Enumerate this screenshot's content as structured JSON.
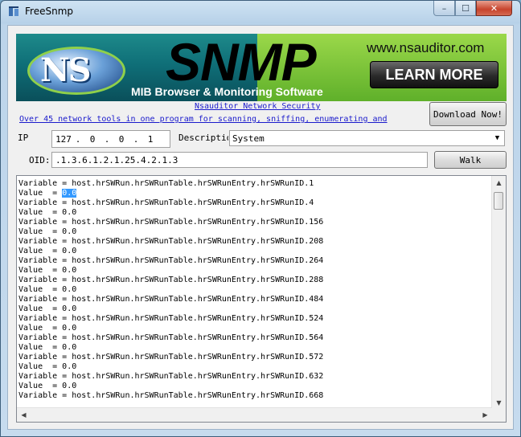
{
  "window": {
    "title": "FreeSnmp",
    "controls": {
      "minimize": "–",
      "maximize": "☐",
      "close": "✕"
    }
  },
  "banner": {
    "logo": "NS",
    "product": "SNMP",
    "subtitle": "MIB Browser & Monitoring Software",
    "url": "www.nsauditor.com",
    "learn_more": "LEARN MORE"
  },
  "links": {
    "vendor": "Nsauditor Network Security",
    "promo": "Over 45 network tools in one program for scanning, sniffing, enumerating and"
  },
  "buttons": {
    "download": "Download Now!",
    "walk": "Walk"
  },
  "form": {
    "ip_label": "IP",
    "ip_octets": [
      "127",
      "0",
      "0",
      "1"
    ],
    "description_label": "Description",
    "description_value": "System",
    "oid_label": "OID:",
    "oid_value": ".1.3.6.1.2.1.25.4.2.1.3"
  },
  "results": {
    "lines": [
      {
        "text": "Variable = host.hrSWRun.hrSWRunTable.hrSWRunEntry.hrSWRunID.1"
      },
      {
        "prefix": "Value  = ",
        "highlight": "0.0"
      },
      {
        "text": "Variable = host.hrSWRun.hrSWRunTable.hrSWRunEntry.hrSWRunID.4"
      },
      {
        "text": "Value  = 0.0"
      },
      {
        "text": "Variable = host.hrSWRun.hrSWRunTable.hrSWRunEntry.hrSWRunID.156"
      },
      {
        "text": "Value  = 0.0"
      },
      {
        "text": "Variable = host.hrSWRun.hrSWRunTable.hrSWRunEntry.hrSWRunID.208"
      },
      {
        "text": "Value  = 0.0"
      },
      {
        "text": "Variable = host.hrSWRun.hrSWRunTable.hrSWRunEntry.hrSWRunID.264"
      },
      {
        "text": "Value  = 0.0"
      },
      {
        "text": "Variable = host.hrSWRun.hrSWRunTable.hrSWRunEntry.hrSWRunID.288"
      },
      {
        "text": "Value  = 0.0"
      },
      {
        "text": "Variable = host.hrSWRun.hrSWRunTable.hrSWRunEntry.hrSWRunID.484"
      },
      {
        "text": "Value  = 0.0"
      },
      {
        "text": "Variable = host.hrSWRun.hrSWRunTable.hrSWRunEntry.hrSWRunID.524"
      },
      {
        "text": "Value  = 0.0"
      },
      {
        "text": "Variable = host.hrSWRun.hrSWRunTable.hrSWRunEntry.hrSWRunID.564"
      },
      {
        "text": "Value  = 0.0"
      },
      {
        "text": "Variable = host.hrSWRun.hrSWRunTable.hrSWRunEntry.hrSWRunID.572"
      },
      {
        "text": "Value  = 0.0"
      },
      {
        "text": "Variable = host.hrSWRun.hrSWRunTable.hrSWRunEntry.hrSWRunID.632"
      },
      {
        "text": "Value  = 0.0"
      },
      {
        "text": "Variable = host.hrSWRun.hrSWRunTable.hrSWRunEntry.hrSWRunID.668"
      }
    ]
  },
  "icons": {
    "scroll_up": "▲",
    "scroll_down": "▼",
    "scroll_left": "◀",
    "scroll_right": "▶",
    "select_arrow": "▼"
  }
}
